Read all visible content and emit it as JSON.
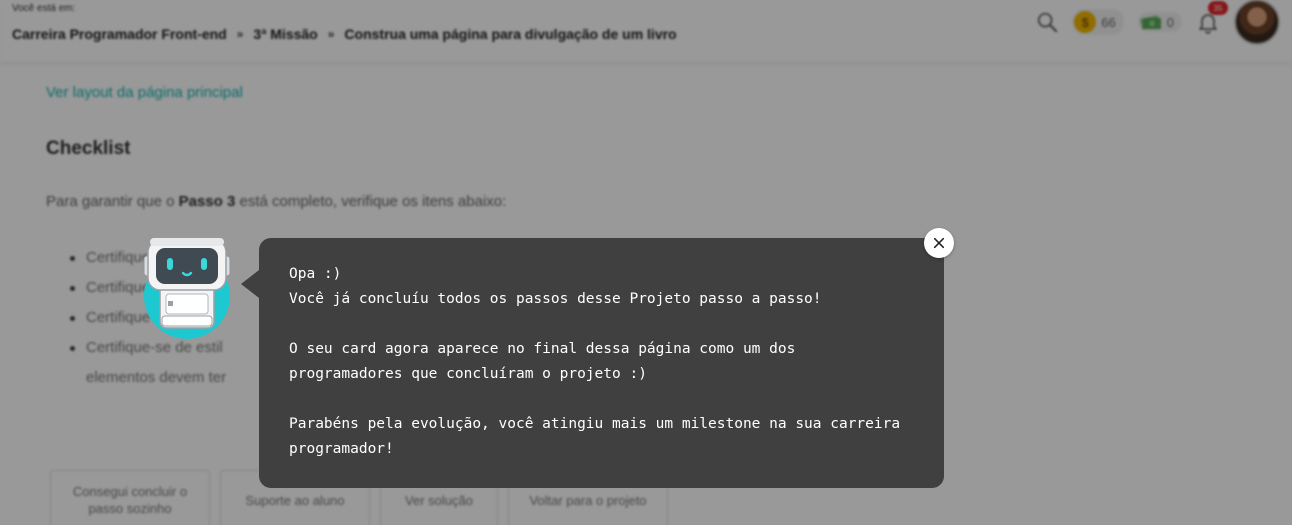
{
  "header": {
    "you_are_here": "Você está em:",
    "breadcrumb": [
      "Carreira Programador Front-end",
      "3ª Missão",
      "Construa uma página para divulgação de um livro"
    ],
    "separator": "»",
    "coins_count": "66",
    "coin_symbol": "$",
    "money_count": "0",
    "notifications_count": "35"
  },
  "content": {
    "layout_link": "Ver layout da página principal",
    "checklist_heading": "Checklist",
    "intro_prefix": "Para garantir que o ",
    "intro_bold": "Passo 3",
    "intro_suffix": " está completo, verifique os itens abaixo:",
    "items": [
      "Certifique-se a co",
      "Certifique-se",
      "Certifique-se aplic",
      "Certifique-se de estil"
    ],
    "item_continuation": "elementos devem ter"
  },
  "actions": [
    "Consegui concluir o passo sozinho",
    "Suporte ao aluno",
    "Ver solução",
    "Voltar para o projeto"
  ],
  "popup": {
    "lines": [
      "Opa :)",
      "Você já concluíu todos os passos desse Projeto passo a passo!",
      "",
      "O seu card agora aparece no final dessa página como um dos",
      "programadores que concluíram o projeto :)",
      "",
      "Parabéns pela evolução, você atingiu mais um milestone na sua carreira",
      "programador!"
    ]
  },
  "colors": {
    "accent": "#14b5b2",
    "bubble": "#404040",
    "robot_teal": "#1ec8d0",
    "badge": "#e0262b"
  }
}
